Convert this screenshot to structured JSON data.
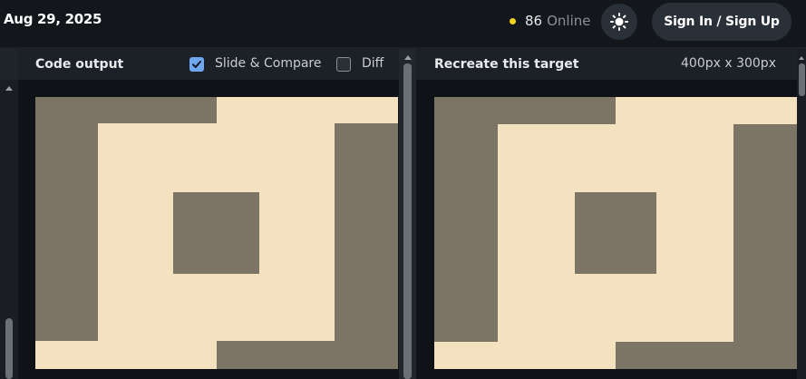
{
  "header": {
    "date": "Aug 29, 2025",
    "online_count": "86",
    "online_label": "Online",
    "theme_toggle_icon": "sun-icon",
    "sign_in_label": "Sign In / Sign Up"
  },
  "left_panel": {
    "title": "Code output",
    "slide_compare_label": "Slide & Compare",
    "slide_compare_checked": true,
    "diff_label": "Diff",
    "diff_checked": false
  },
  "right_panel": {
    "title": "Recreate this target",
    "dimensions": "400px x 300px"
  },
  "colors": {
    "accent_dot": "#f4d21b",
    "checkbox_on": "#6fa6f0",
    "art_background": "#f3e1c0",
    "art_shape": "#7c7465"
  }
}
